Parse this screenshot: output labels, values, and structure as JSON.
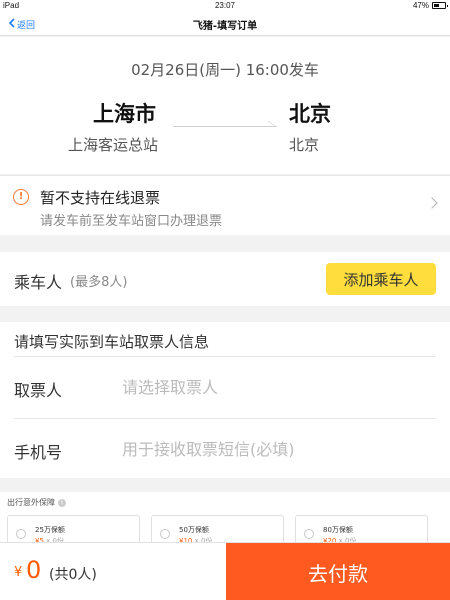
{
  "status_bar": {
    "device": "iPad",
    "time": "23:07",
    "battery": "47%"
  },
  "nav": {
    "back_label": "返回",
    "title": "飞猪-填写订单"
  },
  "trip": {
    "depart_time": "02月26日(周一) 16:00发车",
    "from_city": "上海市",
    "from_station": "上海客运总站",
    "to_city": "北京",
    "to_station": "北京"
  },
  "refund": {
    "title": "暂不支持在线退票",
    "subtitle": "请发车前至发车站窗口办理退票"
  },
  "passenger": {
    "label": "乘车人",
    "limit": "(最多8人)",
    "add_button": "添加乘车人"
  },
  "ticket_info": {
    "heading": "请填写实际到车站取票人信息",
    "collector_label": "取票人",
    "collector_placeholder": "请选择取票人",
    "phone_label": "手机号",
    "phone_placeholder": "用于接收取票短信(必填)"
  },
  "insurance": {
    "heading": "出行意外保障",
    "plans": [
      {
        "amount": "25万保额",
        "price": "¥5",
        "qty": "x 0份"
      },
      {
        "amount": "50万保额",
        "price": "¥10",
        "qty": "x 0份"
      },
      {
        "amount": "80万保额",
        "price": "¥20",
        "qty": "x 0份"
      }
    ]
  },
  "footer": {
    "currency": "¥",
    "total": "0",
    "count": "(共0人)",
    "pay_button": "去付款"
  },
  "colors": {
    "accent": "#ff5a1f",
    "add_button": "#ffdd3c",
    "link": "#1a7dff",
    "warning": "#ff7a2e"
  }
}
